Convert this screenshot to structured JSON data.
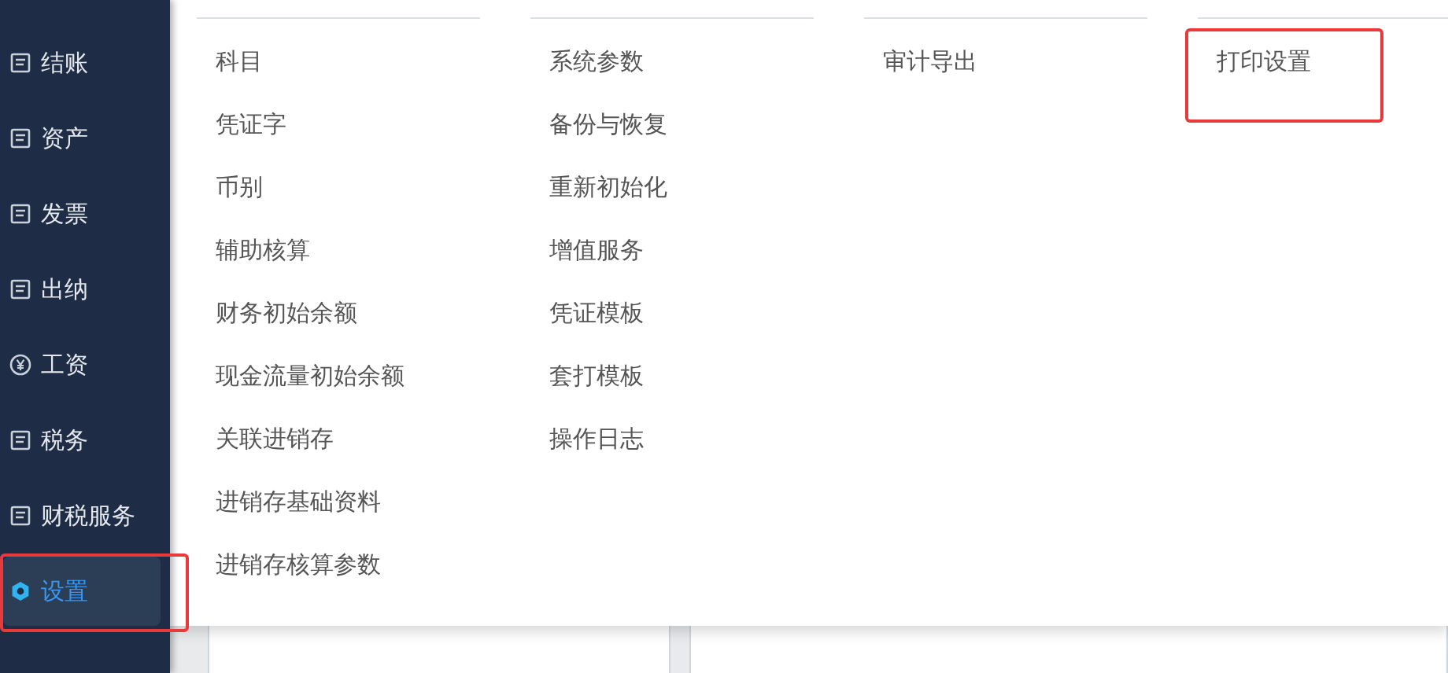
{
  "sidebar": {
    "items": [
      {
        "label": "结账",
        "selected": false,
        "highlighted": false
      },
      {
        "label": "资产",
        "selected": false,
        "highlighted": false
      },
      {
        "label": "发票",
        "selected": false,
        "highlighted": false
      },
      {
        "label": "出纳",
        "selected": false,
        "highlighted": false
      },
      {
        "label": "工资",
        "selected": false,
        "highlighted": false
      },
      {
        "label": "税务",
        "selected": false,
        "highlighted": false
      },
      {
        "label": "财税服务",
        "selected": false,
        "highlighted": false
      },
      {
        "label": "设置",
        "selected": true,
        "highlighted": true
      }
    ]
  },
  "menu": {
    "columns": [
      {
        "items": [
          {
            "label": "科目",
            "highlighted": false
          },
          {
            "label": "凭证字",
            "highlighted": false
          },
          {
            "label": "币别",
            "highlighted": false
          },
          {
            "label": "辅助核算",
            "highlighted": false
          },
          {
            "label": "财务初始余额",
            "highlighted": false
          },
          {
            "label": "现金流量初始余额",
            "highlighted": false
          },
          {
            "label": "关联进销存",
            "highlighted": false
          },
          {
            "label": "进销存基础资料",
            "highlighted": false
          },
          {
            "label": "进销存核算参数",
            "highlighted": false
          }
        ]
      },
      {
        "items": [
          {
            "label": "系统参数",
            "highlighted": false
          },
          {
            "label": "备份与恢复",
            "highlighted": false
          },
          {
            "label": "重新初始化",
            "highlighted": false
          },
          {
            "label": "增值服务",
            "highlighted": false
          },
          {
            "label": "凭证模板",
            "highlighted": false
          },
          {
            "label": "套打模板",
            "highlighted": false
          },
          {
            "label": "操作日志",
            "highlighted": false
          }
        ]
      },
      {
        "items": [
          {
            "label": "审计导出",
            "highlighted": false
          }
        ]
      },
      {
        "items": [
          {
            "label": "打印设置",
            "highlighted": true
          }
        ]
      }
    ]
  }
}
